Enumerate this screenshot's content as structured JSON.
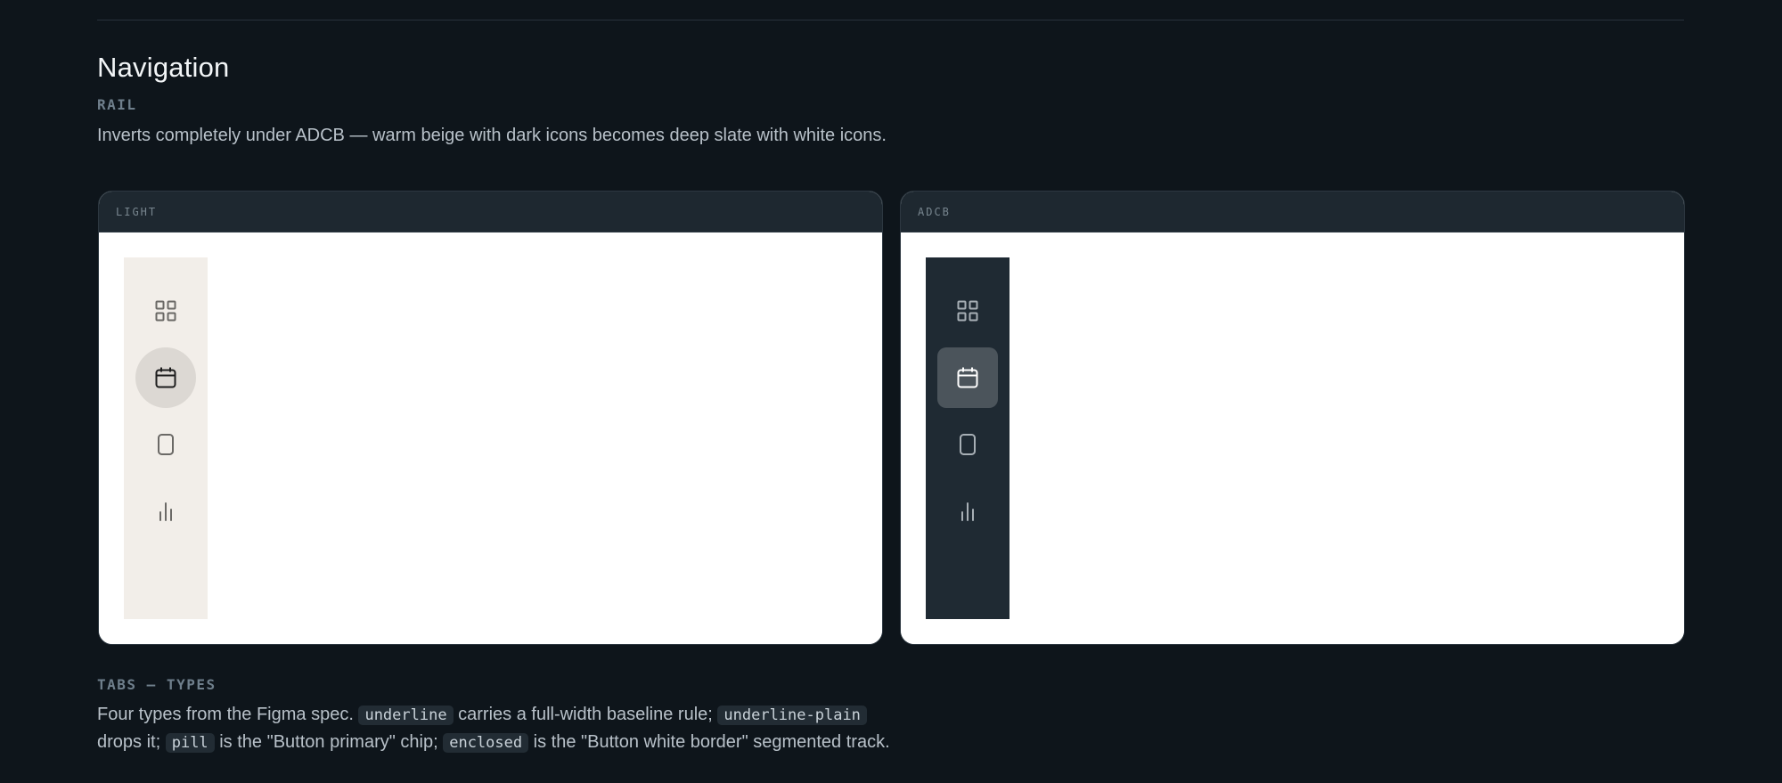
{
  "section": {
    "title": "Navigation"
  },
  "rail": {
    "eyebrow": "RAIL",
    "description": "Inverts completely under ADCB — warm beige with dark icons becomes deep slate with white icons.",
    "cards": [
      {
        "label": "LIGHT",
        "icon_color": "#6b6966",
        "active_icon_color": "#1d1d1d",
        "rail_color": "#f2eee9"
      },
      {
        "label": "ADCB",
        "icon_color": "#a7afb5",
        "active_icon_color": "#ffffff",
        "rail_color": "#1f2a33"
      }
    ],
    "items": [
      {
        "icon": "grid-icon",
        "active": false
      },
      {
        "icon": "calendar-icon",
        "active": true
      },
      {
        "icon": "rectangle-icon",
        "active": false
      },
      {
        "icon": "bar-chart-icon",
        "active": false
      }
    ]
  },
  "tabs_types": {
    "eyebrow": "TABS — TYPES",
    "text_1": "Four types from the Figma spec.",
    "code_1": "underline",
    "text_2": "carries a full-width baseline rule;",
    "code_2": "underline-plain",
    "text_3": "drops it;",
    "code_3": "pill",
    "text_4": "is the \"Button primary\" chip;",
    "code_4": "enclosed",
    "text_5": "is the \"Button white border\" segmented track."
  }
}
